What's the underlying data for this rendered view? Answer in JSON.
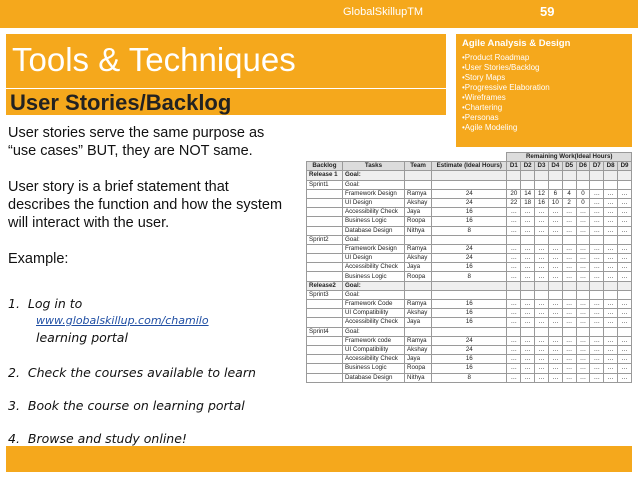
{
  "header": {
    "brand": "GlobalSkillupTM",
    "page_number": "59"
  },
  "title": "Tools & Techniques",
  "subtitle": "User Stories/Backlog",
  "agile_box": {
    "heading": "Agile Analysis & Design",
    "items": [
      "•Product Roadmap",
      "•User Stories/Backlog",
      "•Story Maps",
      "•Progressive Elaboration",
      "•Wireframes",
      "•Chartering",
      "•Personas",
      "•Agile Modeling"
    ]
  },
  "body": {
    "para1": "User stories serve the same purpose as “use cases” BUT, they are NOT same.",
    "para2": "User story is a brief statement that describes the function and how the system will interact with the user.",
    "example": "Example:",
    "steps": [
      {
        "num": "1.",
        "text": "Log in to",
        "link": "www.globalskillup.com/chamilo",
        "tail": "learning portal"
      },
      {
        "num": "2.",
        "text": "Check the courses available to learn"
      },
      {
        "num": "3.",
        "text": "Book the course on learning portal"
      },
      {
        "num": "4.",
        "text": "Browse and study online!"
      }
    ]
  },
  "table": {
    "group_header": "Remaining Work(Ideal Hours)",
    "columns": [
      "Backlog",
      "Tasks",
      "Team",
      "Estimate (Ideal Hours)",
      "D1",
      "D2",
      "D3",
      "D4",
      "D5",
      "D6",
      "D7",
      "D8",
      "D9"
    ],
    "rows": [
      [
        "Release 1",
        "Goal:",
        "",
        "",
        "",
        "",
        "",
        "",
        "",
        "",
        "",
        "",
        ""
      ],
      [
        "Sprint1",
        "Goal:",
        "",
        "",
        "",
        "",
        "",
        "",
        "",
        "",
        "",
        "",
        ""
      ],
      [
        "",
        "Framework Design",
        "Ramya",
        "24",
        "20",
        "14",
        "12",
        "6",
        "4",
        "0",
        "…",
        "…",
        "…"
      ],
      [
        "",
        "UI Design",
        "Akshay",
        "24",
        "22",
        "18",
        "16",
        "10",
        "2",
        "0",
        "…",
        "…",
        "…"
      ],
      [
        "",
        "Accessibility Check",
        "Jaya",
        "16",
        "…",
        "…",
        "…",
        "…",
        "…",
        "…",
        "…",
        "…",
        "…"
      ],
      [
        "",
        "Business Logic",
        "Roopa",
        "16",
        "…",
        "…",
        "…",
        "…",
        "…",
        "…",
        "…",
        "…",
        "…"
      ],
      [
        "",
        "Database Design",
        "Nithya",
        "8",
        "…",
        "…",
        "…",
        "…",
        "…",
        "…",
        "…",
        "…",
        "…"
      ],
      [
        "Sprint2",
        "Goal:",
        "",
        "",
        "",
        "",
        "",
        "",
        "",
        "",
        "",
        "",
        ""
      ],
      [
        "",
        "Framework Design",
        "Ramya",
        "24",
        "…",
        "…",
        "…",
        "…",
        "…",
        "…",
        "…",
        "…",
        "…"
      ],
      [
        "",
        "UI Design",
        "Akshay",
        "24",
        "…",
        "…",
        "…",
        "…",
        "…",
        "…",
        "…",
        "…",
        "…"
      ],
      [
        "",
        "Accessibility Check",
        "Jaya",
        "16",
        "…",
        "…",
        "…",
        "…",
        "…",
        "…",
        "…",
        "…",
        "…"
      ],
      [
        "",
        "Business Logic",
        "Roopa",
        "8",
        "…",
        "…",
        "…",
        "…",
        "…",
        "…",
        "…",
        "…",
        "…"
      ],
      [
        "Release2",
        "Goal:",
        "",
        "",
        "",
        "",
        "",
        "",
        "",
        "",
        "",
        "",
        ""
      ],
      [
        "Sprint3",
        "Goal:",
        "",
        "",
        "",
        "",
        "",
        "",
        "",
        "",
        "",
        "",
        ""
      ],
      [
        "",
        "Framework Code",
        "Ramya",
        "16",
        "…",
        "…",
        "…",
        "…",
        "…",
        "…",
        "…",
        "…",
        "…"
      ],
      [
        "",
        "UI Compatibility",
        "Akshay",
        "16",
        "…",
        "…",
        "…",
        "…",
        "…",
        "…",
        "…",
        "…",
        "…"
      ],
      [
        "",
        "Accessibility Check",
        "Jaya",
        "16",
        "…",
        "…",
        "…",
        "…",
        "…",
        "…",
        "…",
        "…",
        "…"
      ],
      [
        "Sprint4",
        "Goal:",
        "",
        "",
        "",
        "",
        "",
        "",
        "",
        "",
        "",
        "",
        ""
      ],
      [
        "",
        "Framework code",
        "Ramya",
        "24",
        "…",
        "…",
        "…",
        "…",
        "…",
        "…",
        "…",
        "…",
        "…"
      ],
      [
        "",
        "UI Compatibility",
        "Akshay",
        "24",
        "…",
        "…",
        "…",
        "…",
        "…",
        "…",
        "…",
        "…",
        "…"
      ],
      [
        "",
        "Accessibility Check",
        "Jaya",
        "16",
        "…",
        "…",
        "…",
        "…",
        "…",
        "…",
        "…",
        "…",
        "…"
      ],
      [
        "",
        "Business Logic",
        "Roopa",
        "16",
        "…",
        "…",
        "…",
        "…",
        "…",
        "…",
        "…",
        "…",
        "…"
      ],
      [
        "",
        "Database Design",
        "Nithya",
        "8",
        "…",
        "…",
        "…",
        "…",
        "…",
        "…",
        "…",
        "…",
        "…"
      ]
    ]
  },
  "colors": {
    "accent": "#f5a81c",
    "link": "#1f4ea3"
  }
}
